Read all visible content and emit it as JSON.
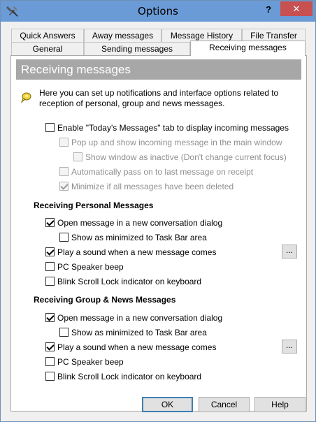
{
  "window": {
    "title": "Options",
    "help_label": "?",
    "close_label": "✕"
  },
  "tabs": {
    "row1": [
      "Quick Answers",
      "Away messages",
      "Message History",
      "File Transfer"
    ],
    "row2": [
      "General",
      "Sending messages",
      "Receiving messages"
    ],
    "active": "Receiving messages"
  },
  "section_title": "Receiving messages",
  "intro": "Here you can set up notifications and interface options related to reception of personal, group and news messages.",
  "general_options": [
    {
      "label": "Enable \"Today's Messages\" tab to display incoming messages",
      "checked": false,
      "enabled": true
    },
    {
      "label": "Pop up and show incoming message in the main window",
      "checked": false,
      "enabled": false
    },
    {
      "label": "Show window as inactive (Don't change current focus)",
      "checked": false,
      "enabled": false
    },
    {
      "label": "Automatically pass on to last message on receipt",
      "checked": false,
      "enabled": false
    },
    {
      "label": "Minimize if all messages have been deleted",
      "checked": true,
      "enabled": false
    }
  ],
  "personal": {
    "heading": "Receiving Personal Messages",
    "options": [
      {
        "label": "Open message in a new conversation dialog",
        "checked": true,
        "enabled": true
      },
      {
        "label": "Show as minimized to Task Bar area",
        "checked": false,
        "enabled": true
      },
      {
        "label": "Play a sound when a new message comes",
        "checked": true,
        "enabled": true
      },
      {
        "label": "PC Speaker beep",
        "checked": false,
        "enabled": true
      },
      {
        "label": "Blink Scroll Lock indicator on keyboard",
        "checked": false,
        "enabled": true
      }
    ],
    "browse_label": "..."
  },
  "group": {
    "heading": "Receiving Group & News Messages",
    "options": [
      {
        "label": "Open message in a new conversation dialog",
        "checked": true,
        "enabled": true
      },
      {
        "label": "Show as minimized to Task Bar area",
        "checked": false,
        "enabled": true
      },
      {
        "label": "Play a sound when a new message comes",
        "checked": true,
        "enabled": true
      },
      {
        "label": "PC Speaker beep",
        "checked": false,
        "enabled": true
      },
      {
        "label": "Blink Scroll Lock indicator on keyboard",
        "checked": false,
        "enabled": true
      }
    ],
    "browse_label": "..."
  },
  "buttons": {
    "ok": "OK",
    "cancel": "Cancel",
    "help": "Help"
  },
  "icons": {
    "app": "tools-icon",
    "info": "lightbulb-speech-icon"
  },
  "colors": {
    "titlebar": "#6b9bd6",
    "close": "#c75050",
    "banner": "#a7a7a7"
  }
}
